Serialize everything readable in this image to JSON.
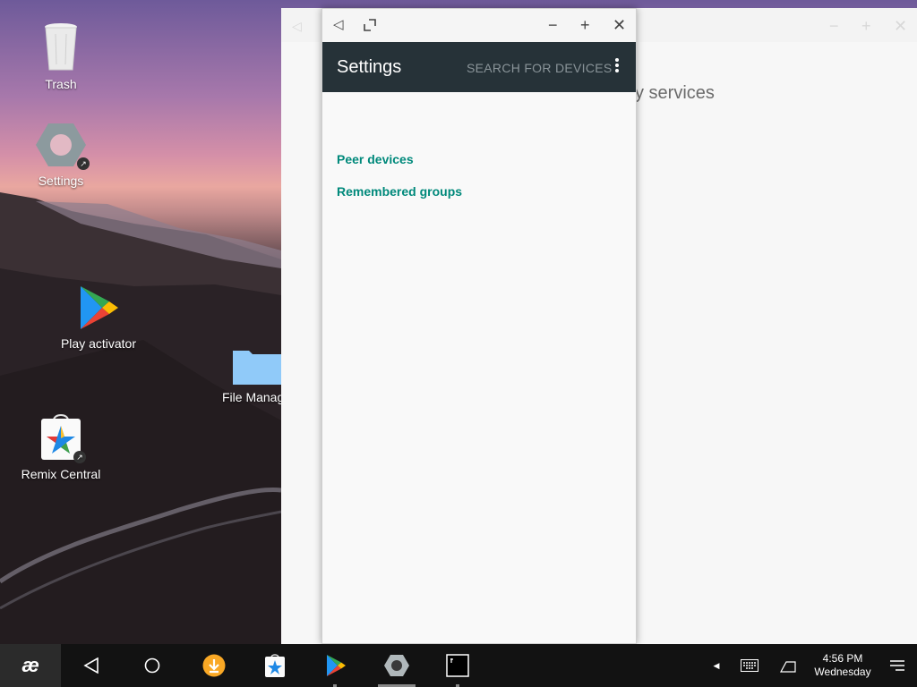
{
  "desktop": {
    "icons": [
      {
        "label": "Trash"
      },
      {
        "label": "Settings"
      },
      {
        "label": "Play activator"
      },
      {
        "label": "File Manag"
      },
      {
        "label": "Remix Central"
      }
    ]
  },
  "background_window": {
    "partial_text": "y services"
  },
  "window": {
    "titlebar": {
      "back_icon": "back-triangle-icon",
      "restore_icon": "restore-icon",
      "minimize_icon": "minimize-icon",
      "maximize_icon": "plus-icon",
      "close_icon": "close-icon"
    },
    "appbar": {
      "title": "Settings",
      "action": "SEARCH FOR DEVICES",
      "menu_icon": "more-vert-icon"
    },
    "preferences": [
      {
        "label": "Peer devices"
      },
      {
        "label": "Remembered groups"
      }
    ]
  },
  "taskbar": {
    "start_glyph": "æ",
    "clock": {
      "time": "4:56 PM",
      "day": "Wednesday"
    },
    "colors": {
      "accent_teal": "#00897b",
      "appbar": "#263238",
      "taskbar": "#121212"
    }
  }
}
